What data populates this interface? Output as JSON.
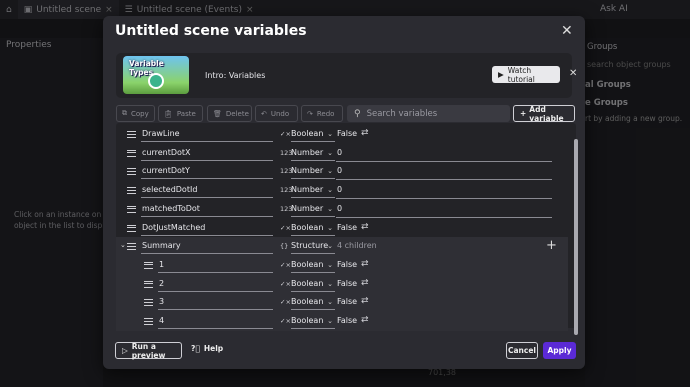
{
  "tabs": [
    {
      "label": "Untitled scene"
    },
    {
      "label": "Untitled scene (Events)"
    }
  ],
  "topbar": {
    "ask_ai": "Ask AI"
  },
  "left_panel": {
    "title": "Properties",
    "hint": "Click on an instance on the object in the list to display th"
  },
  "right_panel": {
    "title": "Groups",
    "search_placeholder": "search object groups",
    "global_groups": "al Groups",
    "scene_groups": "e Groups",
    "hint": "rt by adding a new group."
  },
  "bottom_right": {
    "coords": "701,38"
  },
  "dialog": {
    "title": "Untitled scene variables",
    "tutorial": {
      "thumb_caption": "Variable Types",
      "label": "Intro: Variables",
      "watch_label": "Watch tutorial"
    },
    "toolbar": {
      "copy": "Copy",
      "paste": "Paste",
      "delete": "Delete",
      "undo": "Undo",
      "redo": "Redo",
      "search_placeholder": "Search variables",
      "add_variable": "Add variable"
    },
    "variables": [
      {
        "name": "DrawLine",
        "type": "Boolean",
        "value": "False"
      },
      {
        "name": "currentDotX",
        "type": "Number",
        "value": "0"
      },
      {
        "name": "currentDotY",
        "type": "Number",
        "value": "0"
      },
      {
        "name": "selectedDotId",
        "type": "Number",
        "value": "0"
      },
      {
        "name": "matchedToDot",
        "type": "Number",
        "value": "0"
      },
      {
        "name": "DotJustMatched",
        "type": "Boolean",
        "value": "False"
      },
      {
        "name": "Summary",
        "type": "Structure",
        "value": "4 children"
      },
      {
        "name": "1",
        "type": "Boolean",
        "value": "False"
      },
      {
        "name": "2",
        "type": "Boolean",
        "value": "False"
      },
      {
        "name": "3",
        "type": "Boolean",
        "value": "False"
      },
      {
        "name": "4",
        "type": "Boolean",
        "value": "False"
      }
    ],
    "type_icons": {
      "Boolean": "✓×",
      "Number": "123",
      "Structure": "{}"
    },
    "footer": {
      "run_preview": "Run a preview",
      "help": "Help",
      "cancel": "Cancel",
      "apply": "Apply"
    }
  }
}
